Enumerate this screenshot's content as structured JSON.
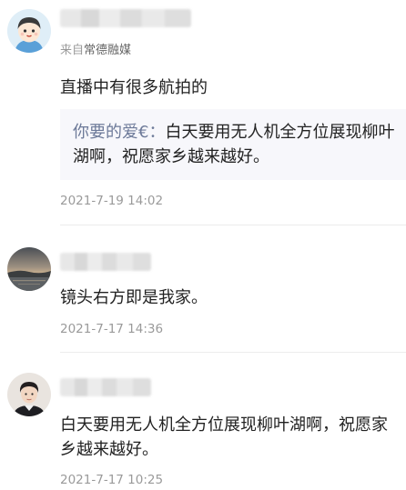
{
  "comments": [
    {
      "source_prefix": "来自",
      "source_name": "常德融媒",
      "text": "直播中有很多航拍的",
      "quote": {
        "user": "你要的爱€",
        "separator": "：",
        "text": "白天要用无人机全方位展现柳叶湖啊，祝愿家乡越来越好。"
      },
      "timestamp": "2021-7-19 14:02",
      "avatar_icon": "cartoon-boy-avatar-icon"
    },
    {
      "text": "镜头右方即是我家。",
      "timestamp": "2021-7-17 14:36",
      "avatar_icon": "lake-sunset-avatar-icon"
    },
    {
      "text": "白天要用无人机全方位展现柳叶湖啊，祝愿家乡越来越好。",
      "timestamp": "2021-7-17 10:25",
      "avatar_icon": "portrait-avatar-icon"
    }
  ],
  "colors": {
    "quote_user": "#6d7a99",
    "quote_bg": "#f7f7fb",
    "timestamp": "#9a9a9a",
    "divider": "#ececec"
  }
}
